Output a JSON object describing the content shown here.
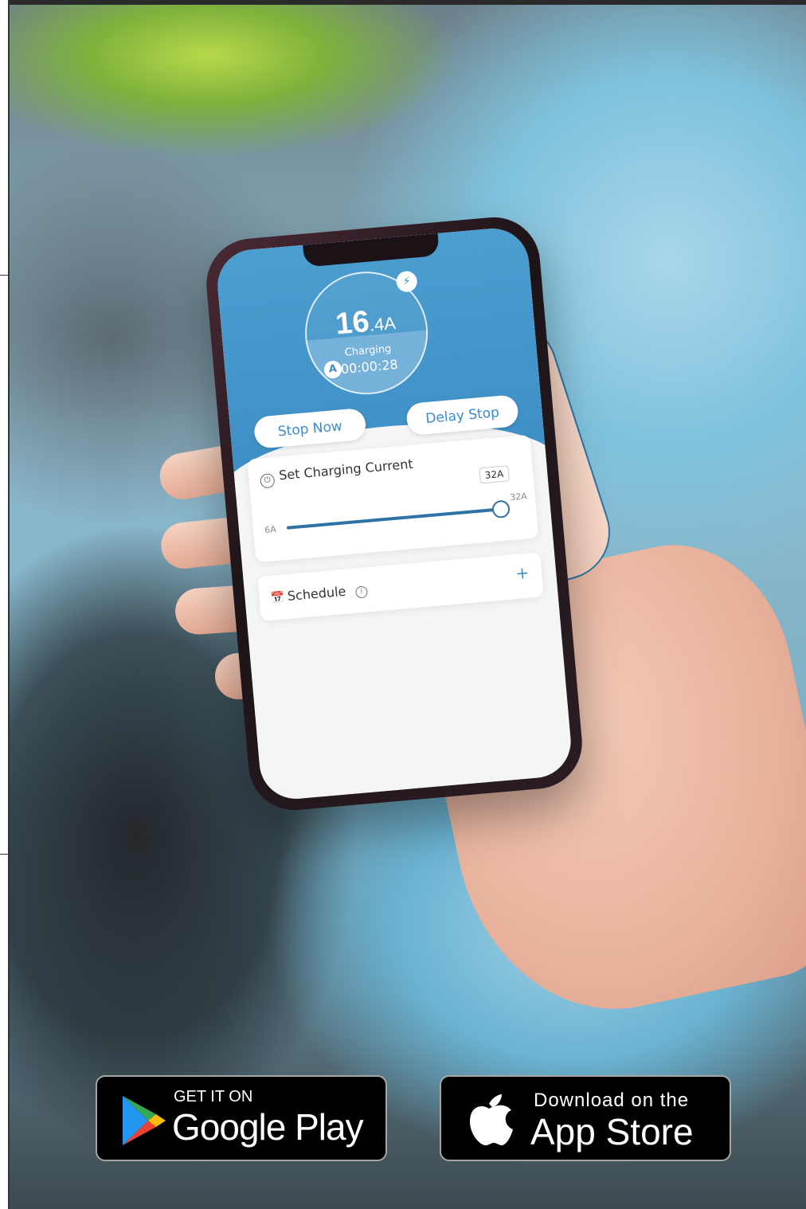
{
  "app": {
    "header": {
      "current_value": "16",
      "current_unit": ".4A",
      "status": "Charging",
      "elapsed": "00:00:28",
      "mode_badge": "A",
      "plug_icon": "ev-plug-icon"
    },
    "actions": {
      "stop_now_label": "Stop Now",
      "delay_stop_label": "Delay Stop"
    },
    "charging_current": {
      "title": "Set Charging Current",
      "icon": "power-icon",
      "min_label": "6A",
      "max_label": "32A",
      "selected_label": "32A",
      "min": 6,
      "max": 32,
      "value": 32
    },
    "schedule": {
      "title": "Schedule",
      "icon": "calendar-clock-icon",
      "info_icon": "info-icon",
      "add_icon": "plus-icon"
    }
  },
  "stores": {
    "google_play": {
      "pre": "GET IT ON",
      "main": "Google Play",
      "icon": "google-play-icon"
    },
    "app_store": {
      "pre": "Download on the",
      "main": "App Store",
      "icon": "apple-icon"
    }
  },
  "colors": {
    "accent_blue": "#3e8fc6",
    "slider_blue": "#2f73a6",
    "badge_black": "#000000"
  }
}
